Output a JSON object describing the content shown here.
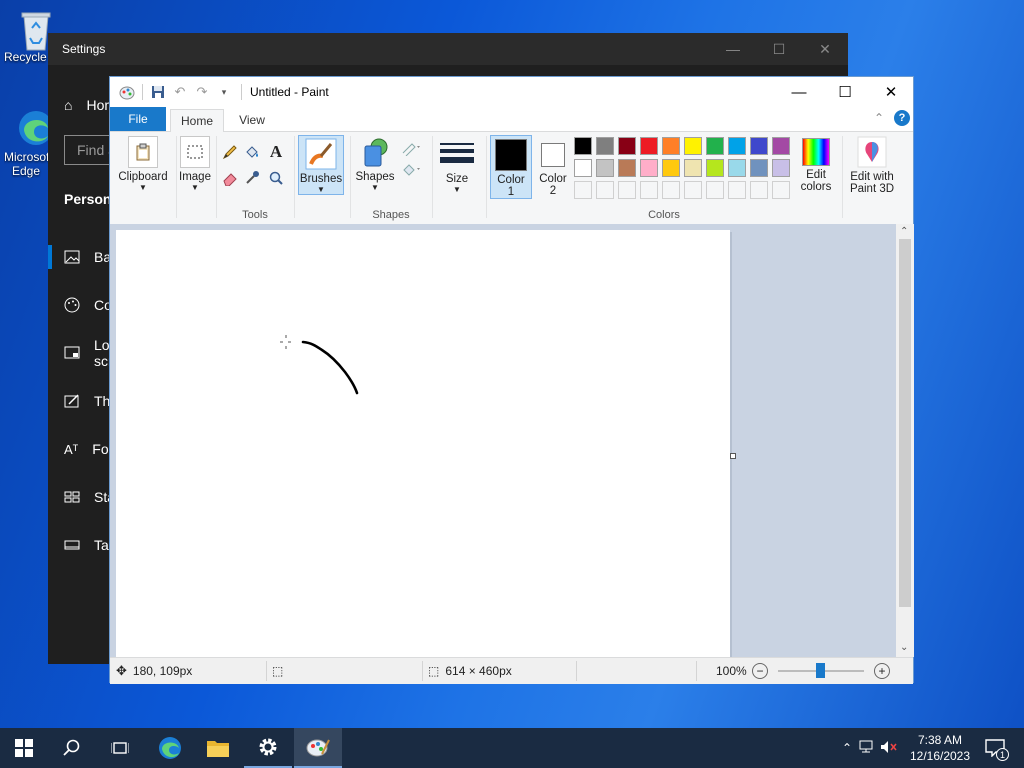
{
  "desktop": {
    "icons": [
      {
        "label": "Recycle Bin"
      },
      {
        "label": "Microsoft Edge"
      }
    ]
  },
  "settings": {
    "title": "Settings",
    "home_label": "Home",
    "search_placeholder": "Find a setting",
    "section": "Personalization",
    "items": [
      {
        "label": "Background"
      },
      {
        "label": "Colors"
      },
      {
        "label": "Lock screen"
      },
      {
        "label": "Themes"
      },
      {
        "label": "Fonts"
      },
      {
        "label": "Start"
      },
      {
        "label": "Taskbar"
      }
    ]
  },
  "paint": {
    "title": "Untitled - Paint",
    "tabs": {
      "file": "File",
      "home": "Home",
      "view": "View"
    },
    "ribbon": {
      "clipboard": "Clipboard",
      "image": "Image",
      "tools": "Tools",
      "brushes": "Brushes",
      "shapes_btn": "Shapes",
      "shapes_group": "Shapes",
      "size": "Size",
      "color1": "Color",
      "color1_num": "1",
      "color2": "Color",
      "color2_num": "2",
      "edit_colors_1": "Edit",
      "edit_colors_2": "colors",
      "colors_group": "Colors",
      "paint3d_1": "Edit with",
      "paint3d_2": "Paint 3D"
    },
    "palette_row1": [
      "#000000",
      "#7f7f7f",
      "#880015",
      "#ed1c24",
      "#ff7f27",
      "#fff200",
      "#22b14c",
      "#00a2e8",
      "#3f48cc",
      "#a349a4"
    ],
    "palette_row2": [
      "#ffffff",
      "#c3c3c3",
      "#b97a57",
      "#ffaec9",
      "#ffc90e",
      "#efe4b0",
      "#b5e61d",
      "#99d9ea",
      "#7092be",
      "#c8bfe7"
    ],
    "accent": "#1979ca",
    "status": {
      "cursor_pos": "180, 109px",
      "canvas_size": "614 × 460px",
      "zoom": "100%"
    }
  },
  "taskbar": {
    "time": "7:38 AM",
    "date": "12/16/2023",
    "notification_count": "1"
  }
}
